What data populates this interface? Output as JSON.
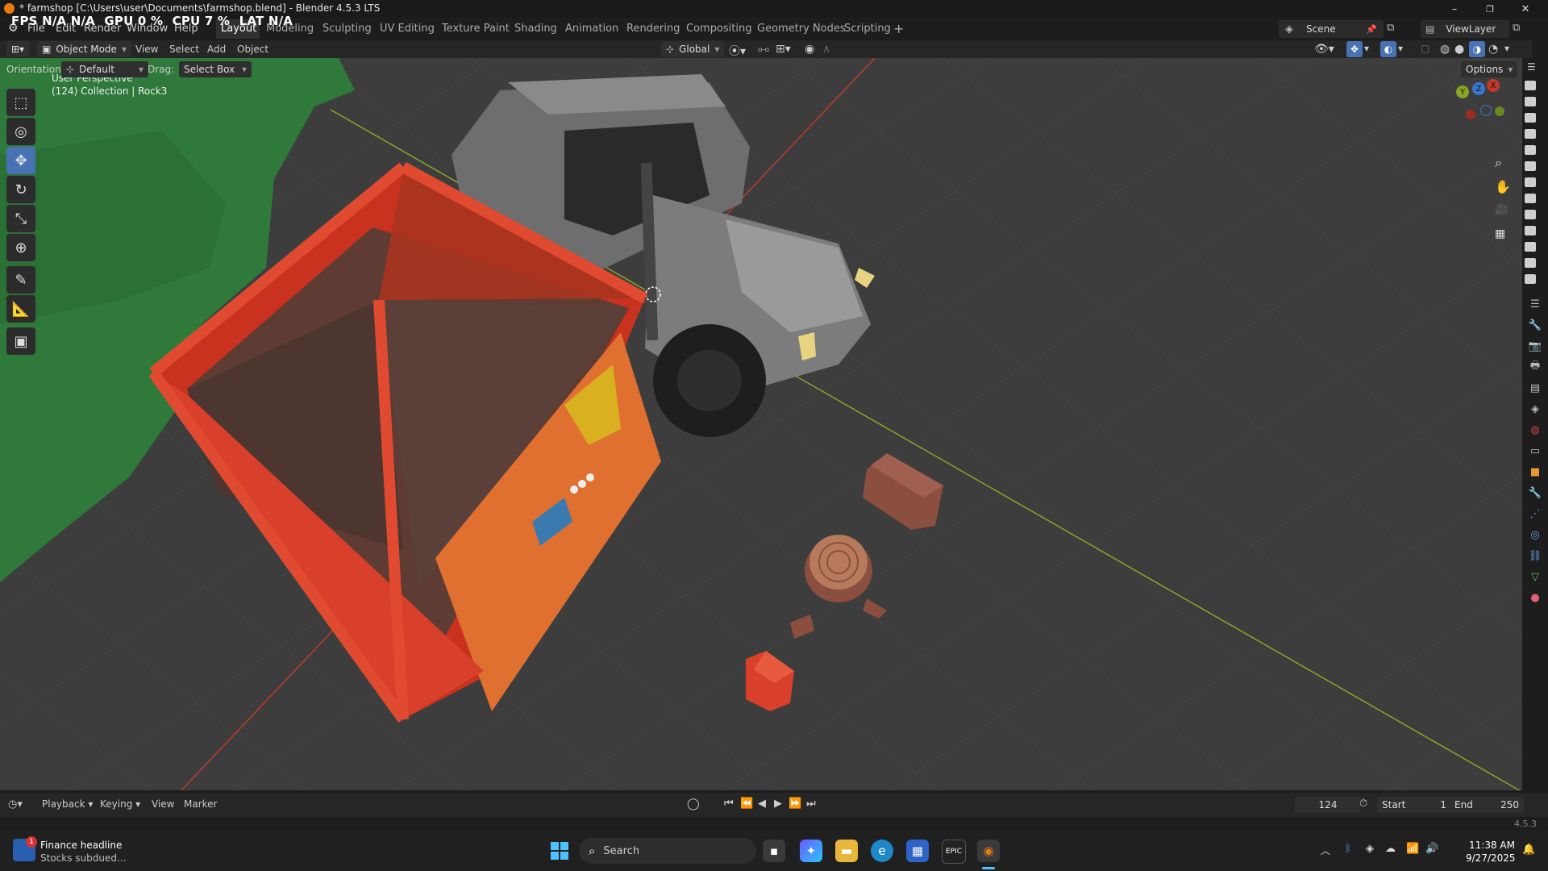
{
  "titlebar": {
    "title": "* farmshop [C:\\Users\\user\\Documents\\farmshop.blend] - Blender 4.5.3 LTS",
    "minimize": "–",
    "maximize": "❐",
    "close": "✕"
  },
  "stats": {
    "fps": "FPS N/A N/A",
    "gpu": "GPU 0 %",
    "cpu": "CPU 7 %",
    "lat": "LAT N/A"
  },
  "menus": [
    "File",
    "Edit",
    "Render",
    "Window",
    "Help"
  ],
  "workspaces": [
    {
      "label": "Layout",
      "active": true
    },
    {
      "label": "Modeling"
    },
    {
      "label": "Sculpting"
    },
    {
      "label": "UV Editing"
    },
    {
      "label": "Texture Paint"
    },
    {
      "label": "Shading"
    },
    {
      "label": "Animation"
    },
    {
      "label": "Rendering"
    },
    {
      "label": "Compositing"
    },
    {
      "label": "Geometry Nodes"
    },
    {
      "label": "Scripting"
    }
  ],
  "add_workspace": "+",
  "scene": {
    "label": "Scene"
  },
  "view_layer": {
    "label": "ViewLayer"
  },
  "header": {
    "mode": "Object Mode",
    "view": "View",
    "select": "Select",
    "add": "Add",
    "object": "Object",
    "transform_orientation": "Global"
  },
  "tool_settings": {
    "orientation_label": "Orientation:",
    "orientation_value": "Default",
    "drag_label": "Drag:",
    "drag_value": "Select Box",
    "options": "Options"
  },
  "viewport": {
    "perspective": "User Perspective",
    "collection": "(124) Collection | Rock3",
    "gizmo_axes": [
      "X",
      "Y",
      "Z"
    ]
  },
  "tools": [
    {
      "name": "select-box",
      "icon": "⬚",
      "active": false
    },
    {
      "name": "cursor",
      "icon": "◎",
      "active": false
    },
    {
      "name": "move",
      "icon": "✥",
      "active": true
    },
    {
      "name": "rotate",
      "icon": "↻",
      "active": false
    },
    {
      "name": "scale",
      "icon": "⤡",
      "active": false
    },
    {
      "name": "transform",
      "icon": "⊕",
      "active": false
    },
    {
      "name": "annotate",
      "icon": "✎",
      "active": false
    },
    {
      "name": "measure",
      "icon": "📐",
      "active": false
    },
    {
      "name": "add-cube",
      "icon": "▣",
      "active": false
    }
  ],
  "timeline": {
    "playback": "Playback",
    "keying": "Keying",
    "view": "View",
    "marker": "Marker",
    "current_frame": "124",
    "start_label": "Start",
    "start_value": "1",
    "end_label": "End",
    "end_value": "250"
  },
  "status": {
    "version": "4.5.3"
  },
  "taskbar": {
    "news_title": "Finance headline",
    "news_sub": "Stocks subdued...",
    "news_badge": "1",
    "search": "Search",
    "time": "11:38 AM",
    "date": "9/27/2025"
  },
  "colors": {
    "accent": "#4772b3",
    "grid": "#3d3d3d",
    "shop_red": "#d23a26",
    "x_axis": "#c0392b",
    "y_axis": "#8aa626"
  }
}
